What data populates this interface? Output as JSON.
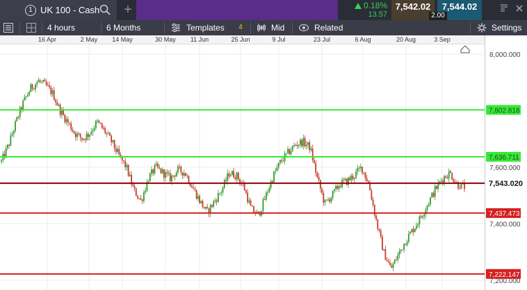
{
  "instrument": {
    "number": "1",
    "name": "UK 100 - Cash"
  },
  "quote": {
    "change_pct": "0.18%",
    "change_abs": "13.57",
    "sell": "7,542.02",
    "spread": "2.00",
    "buy": "7,544.02"
  },
  "toolbar": {
    "interval": "4 hours",
    "range": "6 Months",
    "templates": "Templates",
    "templates_count": "4",
    "price_type": "Mid",
    "related": "Related",
    "settings": "Settings"
  },
  "colors": {
    "up": "#2fd35b",
    "purple": "#5a2d8a",
    "support_line": "#38e838",
    "resistance_line": "#d42020",
    "current_line": "#8b0000"
  },
  "chart_data": {
    "type": "candlestick",
    "x_ticks": [
      "16 Apr",
      "2 May",
      "14 May",
      "30 May",
      "11 Jun",
      "25 Jun",
      "9 Jul",
      "23 Jul",
      "6 Aug",
      "20 Aug",
      "3 Sep"
    ],
    "y_ticks": [
      "8,000.000",
      "7,600.000",
      "7,400.000",
      "7,200.000"
    ],
    "y_tick_values": [
      8000,
      7600,
      7400,
      7200
    ],
    "ylim": [
      7180,
      8010
    ],
    "series": [
      {
        "values": [
          7620,
          7680,
          7760,
          7830,
          7880,
          7905,
          7890,
          7860,
          7800,
          7760,
          7720,
          7700,
          7720,
          7760,
          7730,
          7690,
          7640,
          7600,
          7520,
          7480,
          7560,
          7600,
          7580,
          7560,
          7590,
          7580,
          7530,
          7480,
          7440,
          7480,
          7520,
          7580,
          7570,
          7530,
          7450,
          7430,
          7500,
          7570,
          7620,
          7650,
          7680,
          7690,
          7670,
          7560,
          7470,
          7500,
          7540,
          7550,
          7570,
          7600,
          7540,
          7410,
          7300,
          7240,
          7290,
          7340,
          7380,
          7420,
          7470,
          7520,
          7560,
          7580,
          7540,
          7530
        ]
      }
    ],
    "annotations": [
      {
        "label": "7,802.818",
        "value": 7802.818,
        "kind": "support"
      },
      {
        "label": "7,636.711",
        "value": 7636.711,
        "kind": "support"
      },
      {
        "label": "7,543.020",
        "value": 7543.02,
        "kind": "current"
      },
      {
        "label": "7,437.473",
        "value": 7437.473,
        "kind": "resistance"
      },
      {
        "label": "7,222.147",
        "value": 7222.147,
        "kind": "resistance"
      }
    ]
  }
}
